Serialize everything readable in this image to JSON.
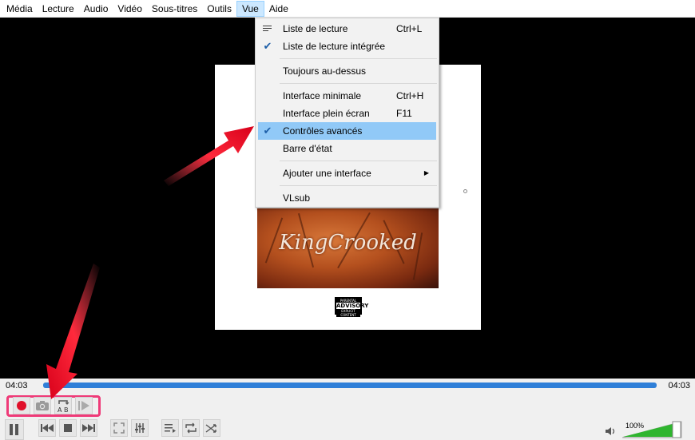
{
  "menubar": {
    "items": [
      "Média",
      "Lecture",
      "Audio",
      "Vidéo",
      "Sous-titres",
      "Outils",
      "Vue",
      "Aide"
    ],
    "active": "Vue"
  },
  "dropdown": {
    "items": [
      {
        "label": "Liste de lecture",
        "shortcut": "Ctrl+L",
        "icon": "playlist-icon"
      },
      {
        "label": "Liste de lecture intégrée",
        "checked": true
      },
      {
        "label": "Toujours au-dessus"
      },
      {
        "label": "Interface minimale",
        "shortcut": "Ctrl+H"
      },
      {
        "label": "Interface plein écran",
        "shortcut": "F11"
      },
      {
        "label": "Contrôles avancés",
        "checked": true,
        "highlighted": true
      },
      {
        "label": "Barre d'état"
      },
      {
        "label": "Ajouter une interface",
        "submenu": true
      },
      {
        "label": "VLsub"
      }
    ]
  },
  "album": {
    "cover_text": "KingCrooked",
    "advisory_top": "PARENTAL",
    "advisory_mid": "ADVISORY",
    "advisory_bot": "EXPLICIT CONTENT"
  },
  "seek": {
    "elapsed": "04:03",
    "total": "04:03",
    "progress": 1.0
  },
  "volume": {
    "percent_label": "100%",
    "level": 1.0
  },
  "colors": {
    "accent_blue": "#2f7fd8",
    "highlight": "#91c9f7",
    "annotation_pink": "#ef3a78",
    "arrow_red": "#e0102a",
    "volume_green": "#2fb52f"
  }
}
